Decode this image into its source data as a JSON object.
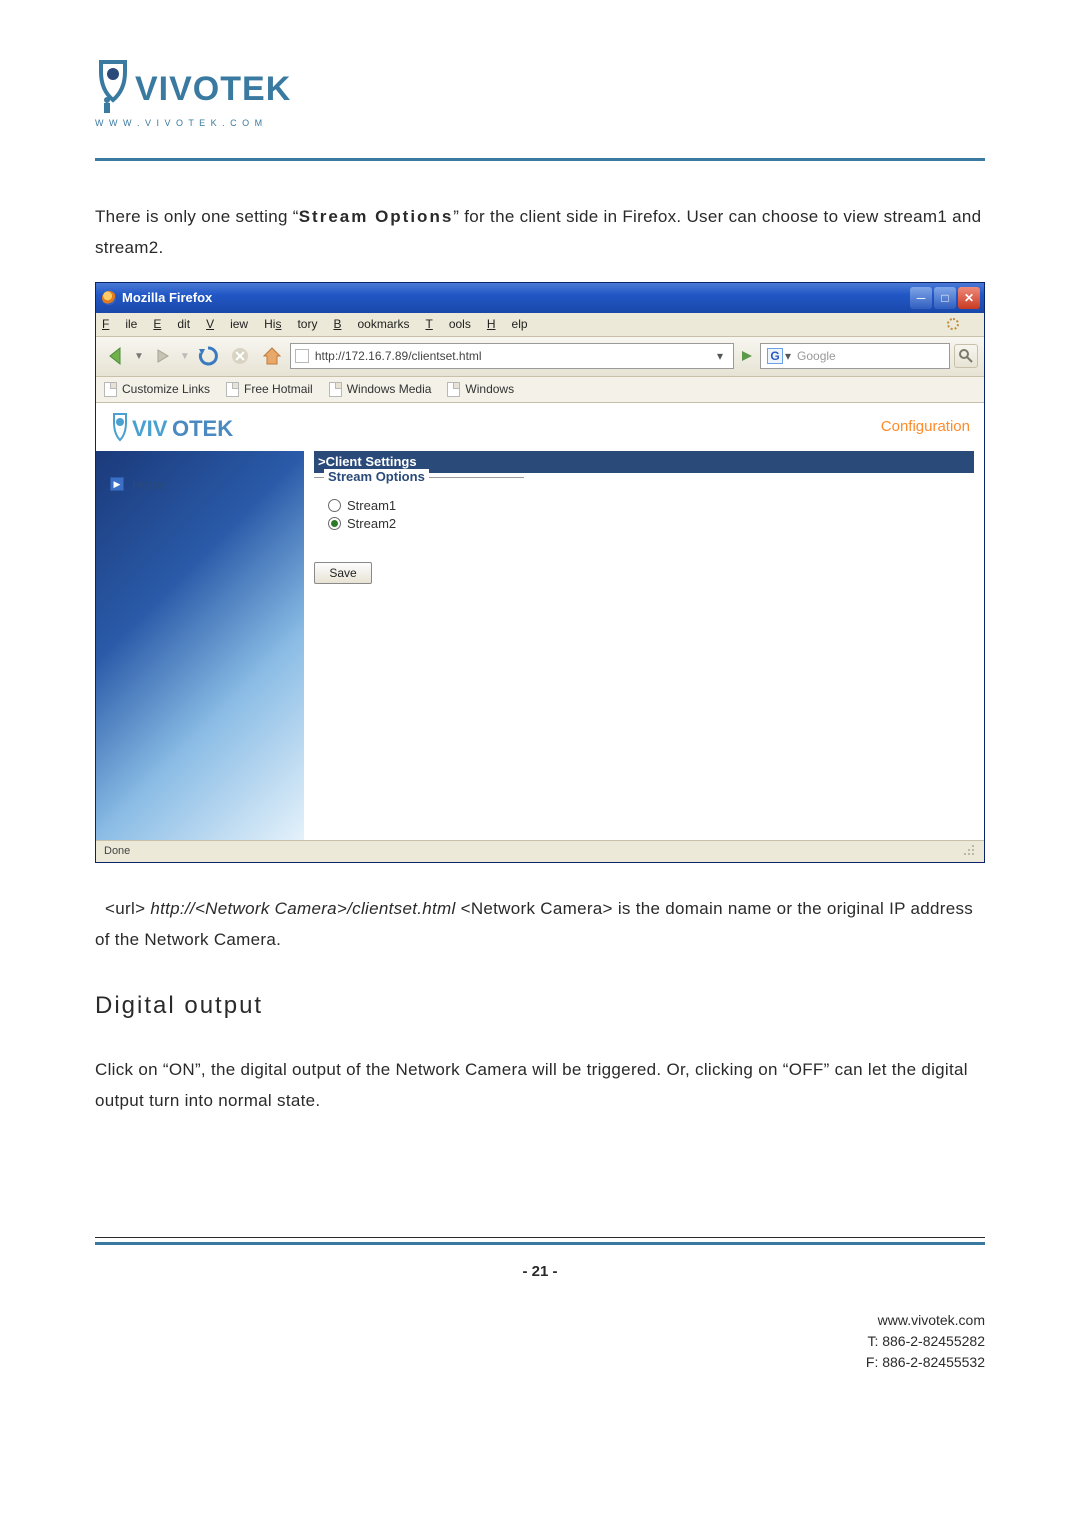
{
  "logo": {
    "brand": "VIVOTEK",
    "url_line": "W W W . V I V O T E K . C O M"
  },
  "para_intro": "There is only one setting “",
  "para_strong": "Stream Options",
  "para_tail": "” for the client side in Firefox. User can choose to view stream1 and stream2.",
  "window": {
    "title": "Mozilla Firefox",
    "menus": {
      "file": "File",
      "edit": "Edit",
      "view": "View",
      "history": "History",
      "bookmarks": "Bookmarks",
      "tools": "Tools",
      "help": "Help"
    },
    "url": "http://172.16.7.89/clientset.html",
    "search_placeholder": "Google",
    "bookmarks": [
      "Customize Links",
      "Free Hotmail",
      "Windows Media",
      "Windows"
    ],
    "sidebar_home": "Home",
    "config_link": "Configuration",
    "section_title": ">Client Settings",
    "fieldset_legend": "Stream Options",
    "opt1": "Stream1",
    "opt2": "Stream2",
    "save": "Save",
    "status": "Done"
  },
  "after": {
    "lead": "<url> ",
    "ital": "http://<Network Camera>/clientset.html",
    "rest": " <Network Camera> is the domain name or the original IP address of the Network Camera."
  },
  "heading": "Digital output",
  "para2": "Click on “ON”, the digital output of the Network Camera will be triggered. Or, clicking on “OFF” can let the digital output turn into normal state.",
  "page_no": "- 21 -",
  "footer": {
    "site": "www.vivotek.com",
    "tel": "T: 886-2-82455282",
    "fax": "F: 886-2-82455532"
  }
}
